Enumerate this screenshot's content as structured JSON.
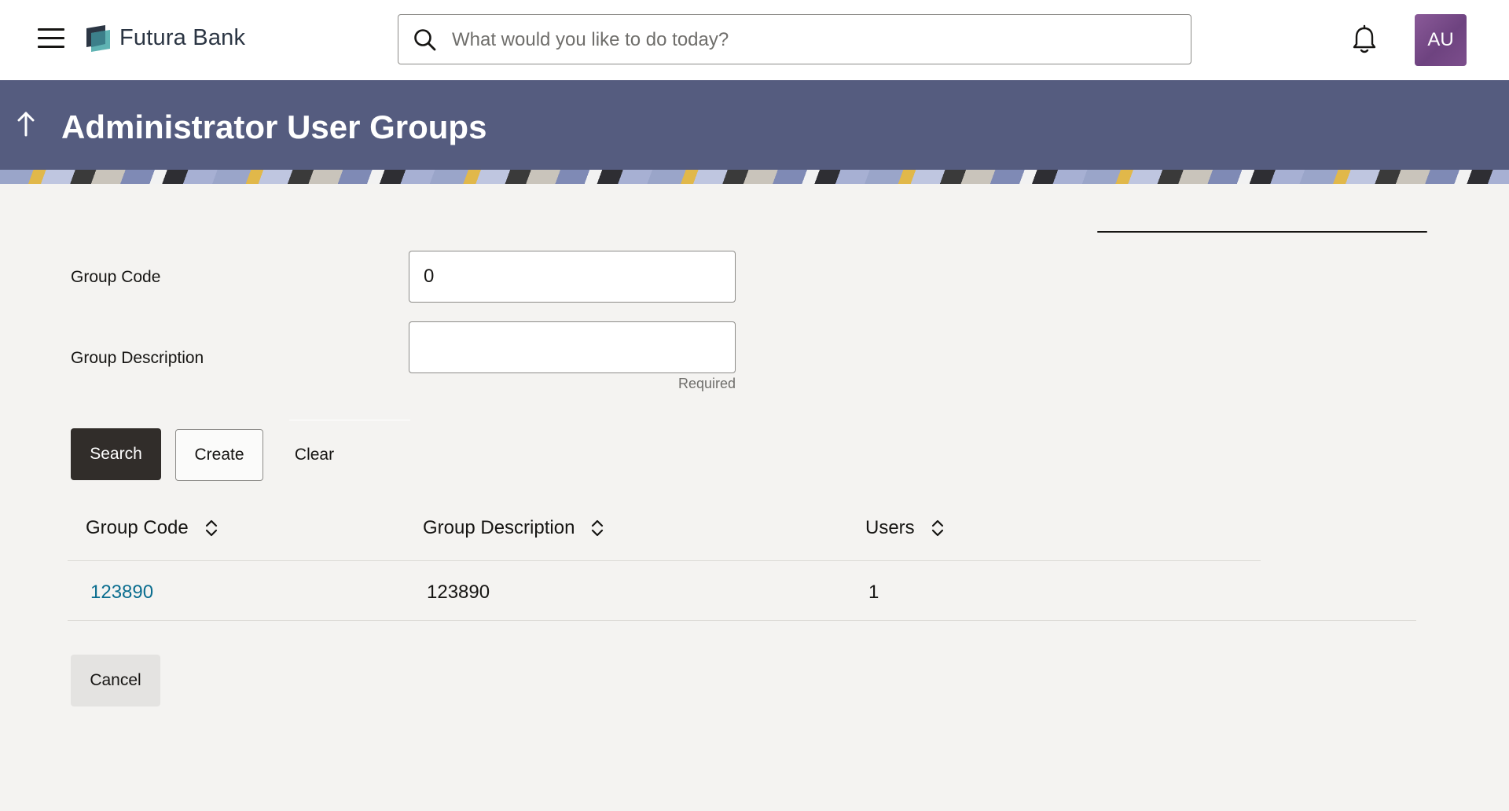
{
  "header": {
    "brand_name": "Futura Bank",
    "search_placeholder": "What would you like to do today?",
    "avatar_initials": "AU",
    "icons": [
      "menu-icon",
      "bank-logo-icon",
      "search-icon",
      "bell-icon"
    ]
  },
  "banner": {
    "title": "Administrator User Groups",
    "back_icon": "arrow-up-icon"
  },
  "form": {
    "group_code_label": "Group Code",
    "group_code_value": "0",
    "group_description_label": "Group Description",
    "group_description_value": "",
    "group_description_hint": "Required"
  },
  "actions": {
    "search_label": "Search",
    "create_label": "Create",
    "clear_label": "Clear",
    "cancel_label": "Cancel"
  },
  "table": {
    "columns": [
      {
        "label": "Group Code",
        "sortable": true
      },
      {
        "label": "Group Description",
        "sortable": true
      },
      {
        "label": "Users",
        "sortable": true
      }
    ],
    "rows": [
      {
        "group_code": "123890",
        "group_description": "123890",
        "users": "1"
      }
    ]
  },
  "colors": {
    "banner": "#555c7f",
    "primary_button": "#312d2a",
    "link": "#0a6d8f",
    "avatar": "#7c4e8c",
    "page_background": "#f4f3f1"
  }
}
